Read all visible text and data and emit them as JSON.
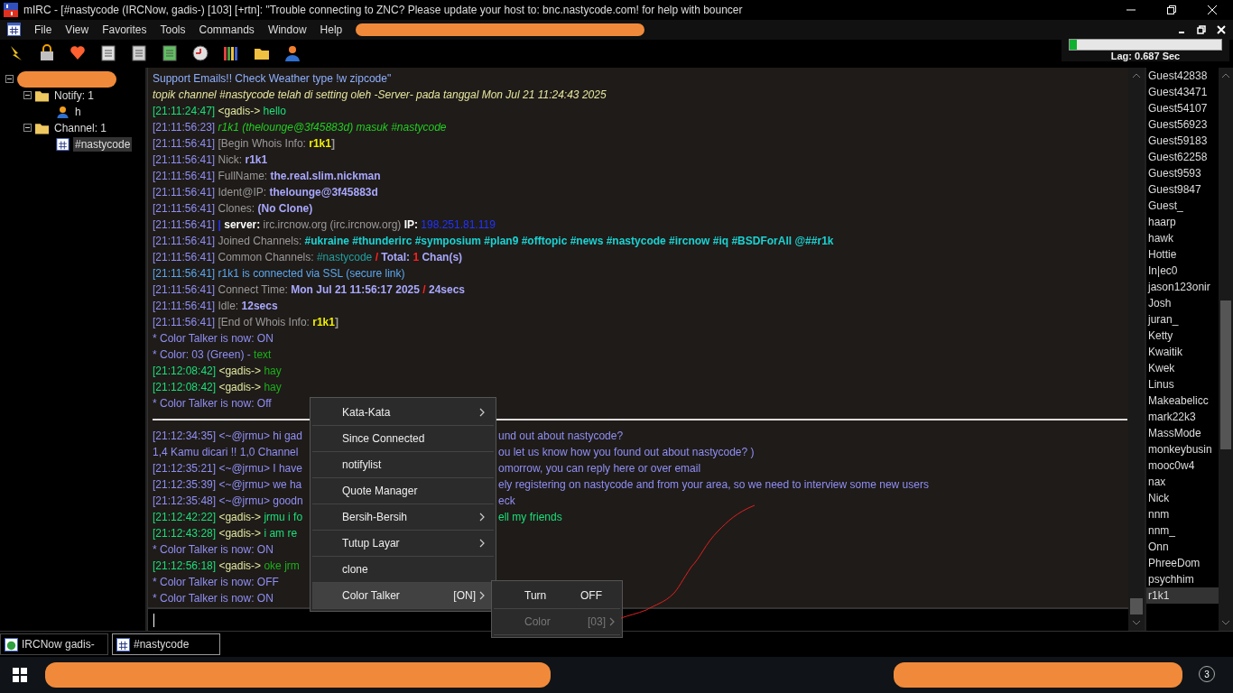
{
  "window": {
    "title": "mIRC - [#nastycode (IRCNow, gadis-) [103] [+rtn]: \"Trouble connecting to ZNC? Please update your host to: bnc.nastycode.com! for help with bouncer"
  },
  "menu": [
    "File",
    "View",
    "Favorites",
    "Tools",
    "Commands",
    "Window",
    "Help"
  ],
  "lag": {
    "level": 0.05,
    "text": "Lag: 0.687 Sec"
  },
  "tree": [
    {
      "label": "Notify: 1",
      "kind": "folder",
      "children": [
        {
          "label": "h",
          "kind": "person",
          "selected": false
        }
      ]
    },
    {
      "label": "Channel: 1",
      "kind": "folder",
      "children": [
        {
          "label": "#nastycode",
          "kind": "channel",
          "selected": true
        }
      ]
    }
  ],
  "chat": [
    {
      "kind": "text",
      "segments": [
        {
          "text": "  Support Emails!!  Check Weather type !w zipcode\"",
          "color": "#8fb0ff"
        }
      ]
    },
    {
      "kind": "text",
      "segments": [
        {
          "text": " topik channel #nastycode telah di setting oleh -Server- pada tanggal Mon Jul 21 11:24:43 2025",
          "color": "#e6e6a0",
          "italic": true
        }
      ]
    },
    {
      "kind": "text",
      "segments": [
        {
          "text": "[21:11:24:47] ",
          "color": "#19e07a"
        },
        {
          "text": "<gadis->",
          "color": "#e0e8a0"
        },
        {
          "text": " hello",
          "color": "#19e07a"
        }
      ]
    },
    {
      "kind": "text",
      "segments": [
        {
          "text": "[21:11:56:23] ",
          "color": "#8f8ff5"
        },
        {
          "text": " r1k1 (thelounge@3f45883d) masuk #nastycode",
          "color": "#22cc22",
          "italic": true
        }
      ]
    },
    {
      "kind": "text",
      "segments": [
        {
          "text": "[21:11:56:41] ",
          "color": "#8f8ff5"
        },
        {
          "text": "[Begin Whois Info: ",
          "color": "#9a9a9a"
        },
        {
          "text": "r1k1",
          "color": "#f0f000",
          "bold": true
        },
        {
          "text": "]",
          "color": "#9a9a9a",
          "bold": true
        }
      ]
    },
    {
      "kind": "text",
      "segments": [
        {
          "text": "[21:11:56:41] ",
          "color": "#8f8ff5"
        },
        {
          "text": "Nick: ",
          "color": "#9a9a9a"
        },
        {
          "text": "r1k1",
          "color": "#a8a8ff",
          "bold": true
        }
      ]
    },
    {
      "kind": "text",
      "segments": [
        {
          "text": "[21:11:56:41] ",
          "color": "#8f8ff5"
        },
        {
          "text": "FullName: ",
          "color": "#9a9a9a"
        },
        {
          "text": "the.real.slim.nickman",
          "color": "#a8a8ff",
          "bold": true
        }
      ]
    },
    {
      "kind": "text",
      "segments": [
        {
          "text": "[21:11:56:41] ",
          "color": "#8f8ff5"
        },
        {
          "text": "Ident@IP: ",
          "color": "#9a9a9a"
        },
        {
          "text": "thelounge@3f45883d",
          "color": "#a8a8ff",
          "bold": true
        }
      ]
    },
    {
      "kind": "text",
      "segments": [
        {
          "text": "[21:11:56:41] ",
          "color": "#8f8ff5"
        },
        {
          "text": "Clones: ",
          "color": "#9a9a9a"
        },
        {
          "text": "(No Clone)",
          "color": "#a8a8ff",
          "bold": true
        }
      ]
    },
    {
      "kind": "text",
      "segments": [
        {
          "text": "[21:11:56:41] ",
          "color": "#8f8ff5"
        },
        {
          "text": " | ",
          "color": "#2233ff",
          "bold": true
        },
        {
          "text": "server: ",
          "color": "#ffffff",
          "bold": true
        },
        {
          "text": "irc.ircnow.org (irc.ircnow.org) ",
          "color": "#9a9a9a"
        },
        {
          "text": "IP: ",
          "color": "#ffffff",
          "bold": true
        },
        {
          "text": "198.251.81.119",
          "color": "#2233ff"
        }
      ]
    },
    {
      "kind": "text",
      "segments": [
        {
          "text": "[21:11:56:41] ",
          "color": "#8f8ff5"
        },
        {
          "text": "Joined Channels: ",
          "color": "#9a9a9a"
        },
        {
          "text": "#ukraine #thunderirc #symposium #plan9 #offtopic #news #nastycode #ircnow #iq #BSDForAll @##r1k",
          "color": "#19d3d3",
          "bold": true
        }
      ]
    },
    {
      "kind": "text",
      "segments": [
        {
          "text": "[21:11:56:41] ",
          "color": "#8f8ff5"
        },
        {
          "text": "Common Channels: ",
          "color": "#9a9a9a"
        },
        {
          "text": "#nastycode",
          "color": "#20a0a0"
        },
        {
          "text": " / ",
          "color": "#ff2020",
          "bold": true
        },
        {
          "text": "Total: ",
          "color": "#a8a8ff",
          "bold": true
        },
        {
          "text": "1",
          "color": "#ff2020",
          "bold": true
        },
        {
          "text": " Chan(s)",
          "color": "#a8a8ff",
          "bold": true
        }
      ]
    },
    {
      "kind": "text",
      "segments": [
        {
          "text": "[21:11:56:41] r1k1 is connected via SSL (secure link)",
          "color": "#5aa8f0"
        }
      ]
    },
    {
      "kind": "text",
      "segments": [
        {
          "text": "[21:11:56:41] ",
          "color": "#8f8ff5"
        },
        {
          "text": "Connect Time: ",
          "color": "#9a9a9a"
        },
        {
          "text": "Mon Jul 21 11:56:17 2025",
          "color": "#a8a8ff",
          "bold": true
        },
        {
          "text": " / ",
          "color": "#ff2020",
          "bold": true
        },
        {
          "text": "24secs",
          "color": "#a8a8ff",
          "bold": true
        }
      ]
    },
    {
      "kind": "text",
      "segments": [
        {
          "text": "[21:11:56:41] ",
          "color": "#8f8ff5"
        },
        {
          "text": "Idle: ",
          "color": "#9a9a9a"
        },
        {
          "text": "12secs",
          "color": "#a8a8ff",
          "bold": true
        }
      ]
    },
    {
      "kind": "text",
      "segments": [
        {
          "text": "[21:11:56:41] ",
          "color": "#8f8ff5"
        },
        {
          "text": "[End of Whois Info: ",
          "color": "#9a9a9a"
        },
        {
          "text": "r1k1",
          "color": "#f0f000",
          "bold": true
        },
        {
          "text": "]",
          "color": "#9a9a9a",
          "bold": true
        }
      ]
    },
    {
      "kind": "text",
      "segments": [
        {
          "text": "* Color Talker is now: ON",
          "color": "#8f8ff5"
        }
      ]
    },
    {
      "kind": "text",
      "segments": [
        {
          "text": "* Color: 03 (Green) - ",
          "color": "#8f8ff5"
        },
        {
          "text": "text",
          "color": "#1ab01a"
        }
      ]
    },
    {
      "kind": "text",
      "segments": [
        {
          "text": "[21:12:08:42] ",
          "color": "#19e07a"
        },
        {
          "text": "<gadis->",
          "color": "#e0e8a0"
        },
        {
          "text": " hay",
          "color": "#1ab01a"
        }
      ]
    },
    {
      "kind": "text",
      "segments": [
        {
          "text": "[21:12:08:42] ",
          "color": "#19e07a"
        },
        {
          "text": "<gadis->",
          "color": "#e0e8a0"
        },
        {
          "text": " hay",
          "color": "#1ab01a"
        }
      ]
    },
    {
      "kind": "text",
      "segments": [
        {
          "text": "* Color Talker is now: Off",
          "color": "#8f8ff5"
        }
      ]
    },
    {
      "kind": "marker"
    },
    {
      "kind": "text",
      "segments": [
        {
          "text": "[21:12:34:35] <~@jrmu> hi gad",
          "color": "#8f8ff5"
        }
      ],
      "after": [
        {
          "text": "und out about nastycode?",
          "color": "#8f8ff5"
        }
      ]
    },
    {
      "kind": "text",
      "segments": [
        {
          "text": "1,4 Kamu dicari !! 1,0 Channel",
          "color": "#8f8ff5"
        }
      ],
      "after": [
        {
          "text": "ou let us know how you found out about nastycode? )",
          "color": "#8f8ff5"
        }
      ]
    },
    {
      "kind": "text",
      "segments": [
        {
          "text": "[21:12:35:21] <~@jrmu> I have",
          "color": "#8f8ff5"
        }
      ],
      "after": [
        {
          "text": "omorrow, you can reply here or over email",
          "color": "#8f8ff5"
        }
      ]
    },
    {
      "kind": "text",
      "segments": [
        {
          "text": "[21:12:35:39] <~@jrmu> we ha",
          "color": "#8f8ff5"
        }
      ],
      "after": [
        {
          "text": "ely registering on nastycode and from your area, so we need to interview some new users",
          "color": "#8f8ff5"
        }
      ]
    },
    {
      "kind": "text",
      "segments": [
        {
          "text": "[21:12:35:48] <~@jrmu> goodn",
          "color": "#8f8ff5"
        }
      ],
      "after": [
        {
          "text": "eck",
          "color": "#8f8ff5"
        }
      ]
    },
    {
      "kind": "text",
      "segments": [
        {
          "text": "[21:12:42:22] ",
          "color": "#19e07a"
        },
        {
          "text": "<gadis->",
          "color": "#e0e8a0"
        },
        {
          "text": " jrmu i fo",
          "color": "#19e07a"
        }
      ],
      "after": [
        {
          "text": "ell my friends",
          "color": "#19e07a"
        }
      ]
    },
    {
      "kind": "text",
      "segments": [
        {
          "text": "[21:12:43:28] ",
          "color": "#19e07a"
        },
        {
          "text": "<gadis->",
          "color": "#e0e8a0"
        },
        {
          "text": " i am re",
          "color": "#19e07a"
        }
      ]
    },
    {
      "kind": "text",
      "segments": [
        {
          "text": "* Color Talker is now: ON",
          "color": "#8f8ff5"
        }
      ]
    },
    {
      "kind": "text",
      "segments": [
        {
          "text": "[21:12:56:18] ",
          "color": "#19e07a"
        },
        {
          "text": "<gadis->",
          "color": "#e0e8a0"
        },
        {
          "text": " oke jrm",
          "color": "#1ab01a"
        }
      ]
    },
    {
      "kind": "text",
      "segments": [
        {
          "text": "* Color Talker is now: OFF",
          "color": "#8f8ff5"
        }
      ]
    },
    {
      "kind": "text",
      "segments": [
        {
          "text": "* Color Talker is now: ON",
          "color": "#8f8ff5"
        }
      ]
    }
  ],
  "context_menu": [
    {
      "label": "Kata-Kata",
      "kind": "submenu",
      "selected": false
    },
    {
      "label": "Since Connected",
      "kind": "item",
      "selected": false
    },
    {
      "label": "notifylist",
      "kind": "item",
      "selected": false
    },
    {
      "label": "Quote Manager",
      "kind": "item",
      "selected": false
    },
    {
      "label": "Bersih-Bersih",
      "kind": "submenu",
      "selected": false
    },
    {
      "label": "Tutup Layar",
      "kind": "submenu",
      "selected": false
    },
    {
      "label": "clone",
      "kind": "item",
      "selected": false
    },
    {
      "label": "Color Talker",
      "kind": "submenu",
      "value": "[ON]",
      "selected": true
    }
  ],
  "submenu": [
    {
      "label": "Turn",
      "value": "OFF",
      "kind": "item",
      "disabled": false
    },
    {
      "label": "Color",
      "value": "[03]",
      "kind": "submenu",
      "disabled": true
    }
  ],
  "nicks": [
    {
      "name": "Guest42838",
      "selected": false
    },
    {
      "name": "Guest43471",
      "selected": false
    },
    {
      "name": "Guest54107",
      "selected": false
    },
    {
      "name": "Guest56923",
      "selected": false
    },
    {
      "name": "Guest59183",
      "selected": false
    },
    {
      "name": "Guest62258",
      "selected": false
    },
    {
      "name": "Guest9593",
      "selected": false
    },
    {
      "name": "Guest9847",
      "selected": false
    },
    {
      "name": "Guest_",
      "selected": false
    },
    {
      "name": "haarp",
      "selected": false
    },
    {
      "name": "hawk",
      "selected": false
    },
    {
      "name": "Hottie",
      "selected": false
    },
    {
      "name": "In|ec0",
      "selected": false
    },
    {
      "name": "jason123onir",
      "selected": false
    },
    {
      "name": "Josh",
      "selected": false
    },
    {
      "name": "juran_",
      "selected": false
    },
    {
      "name": "Ketty",
      "selected": false
    },
    {
      "name": "Kwaitik",
      "selected": false
    },
    {
      "name": "Kwek",
      "selected": false
    },
    {
      "name": "Linus",
      "selected": false
    },
    {
      "name": "Makeabelicc",
      "selected": false
    },
    {
      "name": "mark22k3",
      "selected": false
    },
    {
      "name": "MassMode",
      "selected": false
    },
    {
      "name": "monkeybusin",
      "selected": false
    },
    {
      "name": "mooc0w4",
      "selected": false
    },
    {
      "name": "nax",
      "selected": false
    },
    {
      "name": "Nick",
      "selected": false
    },
    {
      "name": "nnm",
      "selected": false
    },
    {
      "name": "nnm_",
      "selected": false
    },
    {
      "name": "Onn",
      "selected": false
    },
    {
      "name": "PhreeDom",
      "selected": false
    },
    {
      "name": "psychhim",
      "selected": false
    },
    {
      "name": "r1k1",
      "selected": true
    }
  ],
  "switchbar": [
    {
      "label": "IRCNow gadis-",
      "kind": "server",
      "selected": false
    },
    {
      "label": "#nastycode",
      "kind": "channel",
      "selected": true
    }
  ],
  "taskbar": {
    "badge": "3"
  }
}
